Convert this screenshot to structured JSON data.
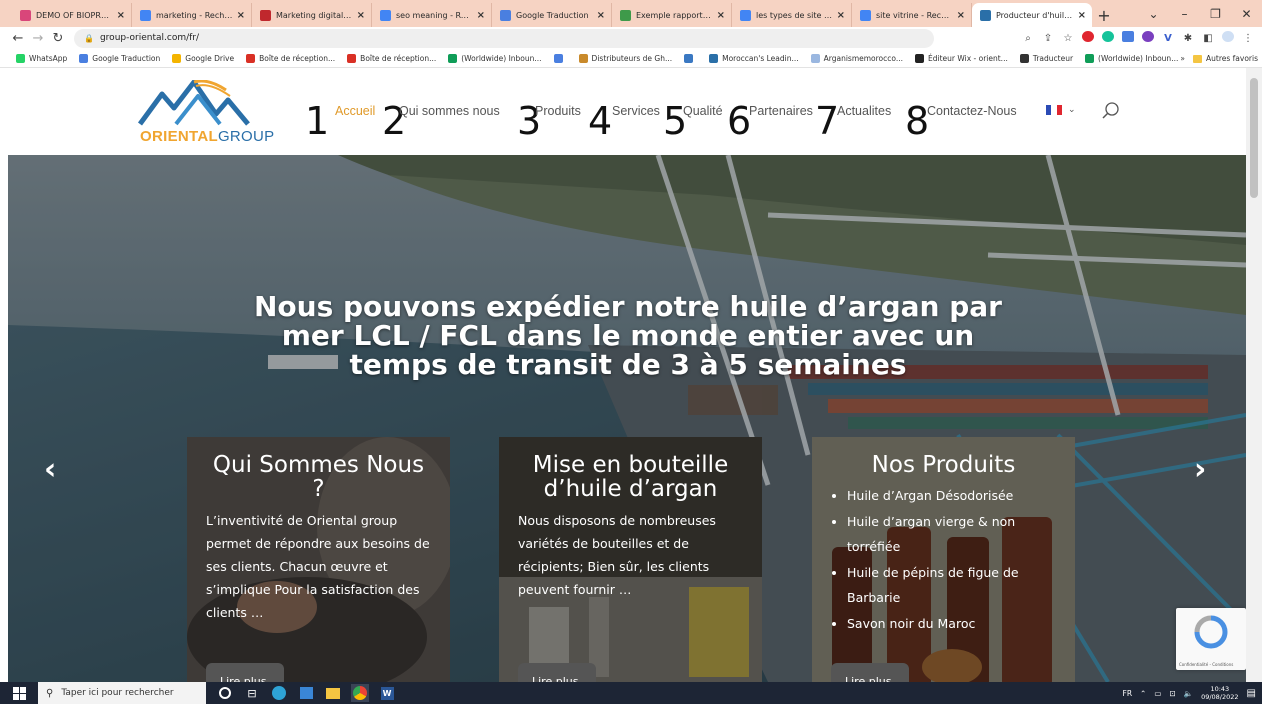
{
  "browser": {
    "tabs": [
      {
        "title": "DEMO OF BIOPROGRE",
        "icon": "pink-circle-icon",
        "color": "#d9467a"
      },
      {
        "title": "marketing - Recherche",
        "icon": "google-icon",
        "color": "#4285f4"
      },
      {
        "title": "Marketing digital : défi",
        "icon": "red-book-icon",
        "color": "#c0282d"
      },
      {
        "title": "seo meaning - Recher",
        "icon": "google-icon",
        "color": "#4285f4"
      },
      {
        "title": "Google Traduction",
        "icon": "translate-icon",
        "color": "#4a7fe0"
      },
      {
        "title": "Exemple rapport de st",
        "icon": "green-doc-icon",
        "color": "#3e9a4a"
      },
      {
        "title": "les types de site web",
        "icon": "google-icon",
        "color": "#4285f4"
      },
      {
        "title": "site vitrine - Recherch",
        "icon": "google-icon",
        "color": "#4285f4"
      },
      {
        "title": "Producteur d'huile d'a",
        "icon": "oriental-logo-icon",
        "color": "#2a6fa8",
        "active": true
      }
    ],
    "new_tab": "+",
    "url": "group-oriental.com/fr/",
    "bookmarks": [
      {
        "label": "WhatsApp",
        "color": "#25d366"
      },
      {
        "label": "Google Traduction",
        "color": "#4a7fe0"
      },
      {
        "label": "Google Drive",
        "color": "#f4b400"
      },
      {
        "label": "Boîte de réception...",
        "color": "#d93025"
      },
      {
        "label": "Boîte de réception...",
        "color": "#d93025"
      },
      {
        "label": "(Worldwide) Inboun...",
        "color": "#0f9d58"
      },
      {
        "label": "",
        "color": "#4a7fe0"
      },
      {
        "label": "Distributeurs de Gh...",
        "color": "#c98a2b"
      },
      {
        "label": "",
        "color": "#3a78c2"
      },
      {
        "label": "Moroccan's Leadin...",
        "color": "#2a6fa8"
      },
      {
        "label": "Arganismemorocco...",
        "color": "#9ab7e0"
      },
      {
        "label": "Éditeur Wix - orient...",
        "color": "#222222"
      },
      {
        "label": "Traducteur",
        "color": "#333333"
      },
      {
        "label": "(Worldwide) Inboun...",
        "color": "#0f9d58"
      }
    ],
    "bookmarks_more": "»",
    "other_bookmarks": "Autres favoris"
  },
  "site": {
    "logo": {
      "part1": "ORIENTAL",
      "part2": "GROUP"
    },
    "menu": [
      {
        "num": "1",
        "label": "Accueil",
        "active": true
      },
      {
        "num": "2",
        "label": "Qui sommes nous"
      },
      {
        "num": "3",
        "label": "Produits"
      },
      {
        "num": "4",
        "label": "Services"
      },
      {
        "num": "5",
        "label": "Qualité"
      },
      {
        "num": "6",
        "label": "Partenaires"
      },
      {
        "num": "7",
        "label": "Actualites"
      },
      {
        "num": "8",
        "label": "Contactez-Nous"
      }
    ],
    "hero": {
      "title": "Nous pouvons expédier notre huile d’argan par mer LCL / FCL dans le monde entier avec un temps de transit de 3 à 5 semaines",
      "prev": "‹",
      "next": "›"
    },
    "cards": [
      {
        "title": "Qui Sommes Nous ?",
        "text": "L’inventivité de Oriental group permet de répondre aux besoins de ses clients. Chacun œuvre et s’implique Pour la satisfaction des clients …",
        "button": "Lire plus"
      },
      {
        "title": "Mise en bouteille d’huile d’argan",
        "text": "Nous disposons de nombreuses variétés de bouteilles et de récipients; Bien sûr, les clients peuvent fournir …",
        "button": "Lire plus"
      },
      {
        "title": "Nos Produits",
        "items": [
          "Huile d’Argan Désodorisée",
          "Huile d’argan vierge & non torréfiée",
          "Huile de pépins de figue de Barbarie",
          "Savon noir du Maroc"
        ],
        "button": "Lire plus"
      }
    ],
    "recaptcha": "Confidentialité - Conditions"
  },
  "taskbar": {
    "search_placeholder": "Taper ici pour rechercher",
    "lang": "FR",
    "time": "10:43",
    "date": "09/08/2022"
  }
}
